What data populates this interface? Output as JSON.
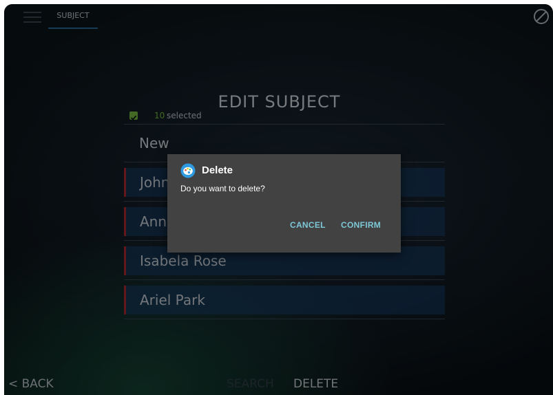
{
  "header": {
    "tab_label": "SUBJECT",
    "menu_icon": "hamburger-menu-icon",
    "right_icon": "no-entry-icon"
  },
  "page": {
    "title": "EDIT SUBJECT"
  },
  "selection": {
    "count": "10",
    "label": "selected"
  },
  "list": {
    "new_label": "New",
    "items": [
      {
        "label": "John"
      },
      {
        "label": "Ann"
      },
      {
        "label": "Isabela Rose"
      },
      {
        "label": "Ariel Park"
      }
    ]
  },
  "footer": {
    "back_label": "< BACK",
    "search_label": "SEARCH",
    "delete_label": "DELETE"
  },
  "dialog": {
    "icon": "app-palette-icon",
    "title": "Delete",
    "message": "Do you want to delete?",
    "cancel_label": "CANCEL",
    "confirm_label": "CONFIRM"
  },
  "colors": {
    "accent_green": "#7ac043",
    "row_marker_red": "#b62a32",
    "dialog_button": "#7ec8d8",
    "dialog_bg": "#424242"
  }
}
